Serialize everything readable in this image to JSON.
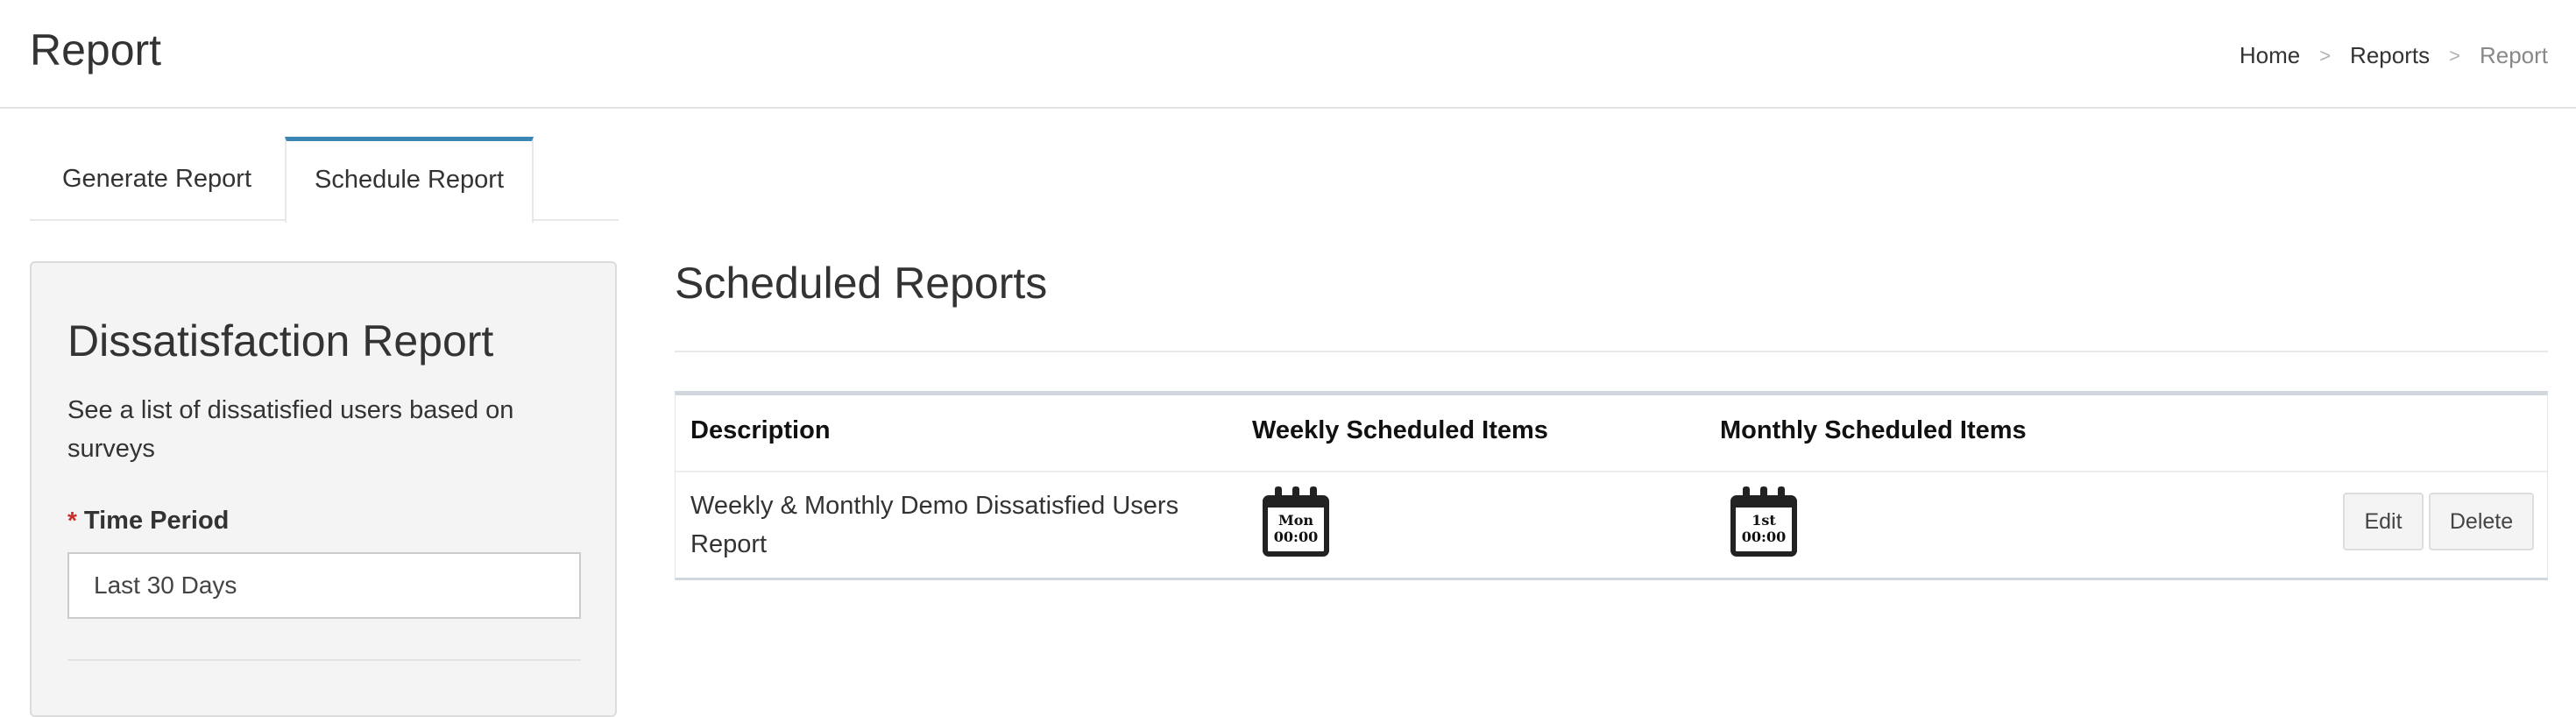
{
  "header": {
    "title": "Report",
    "breadcrumb": {
      "home": "Home",
      "reports": "Reports",
      "current": "Report",
      "separator": ">"
    }
  },
  "tabs": [
    {
      "label": "Generate Report",
      "active": false
    },
    {
      "label": "Schedule Report",
      "active": true
    }
  ],
  "form": {
    "title": "Dissatisfaction Report",
    "description": "See a list of dissatisfied users based on surveys",
    "required_marker": "*",
    "time_period_label": "Time Period",
    "time_period_value": "Last 30 Days"
  },
  "scheduled": {
    "title": "Scheduled Reports",
    "columns": {
      "description": "Description",
      "weekly": "Weekly Scheduled Items",
      "monthly": "Monthly Scheduled Items"
    },
    "rows": [
      {
        "description": "Weekly & Monthly Demo Dissatisfied Users Report",
        "weekly": {
          "day": "Mon",
          "time": "00:00",
          "icon": "calendar-icon"
        },
        "monthly": {
          "day": "1st",
          "time": "00:00",
          "icon": "calendar-icon"
        },
        "edit_label": "Edit",
        "delete_label": "Delete"
      }
    ]
  },
  "colors": {
    "accent": "#3a85b3",
    "required": "#c9302c",
    "panel_bg": "#f4f4f4"
  }
}
